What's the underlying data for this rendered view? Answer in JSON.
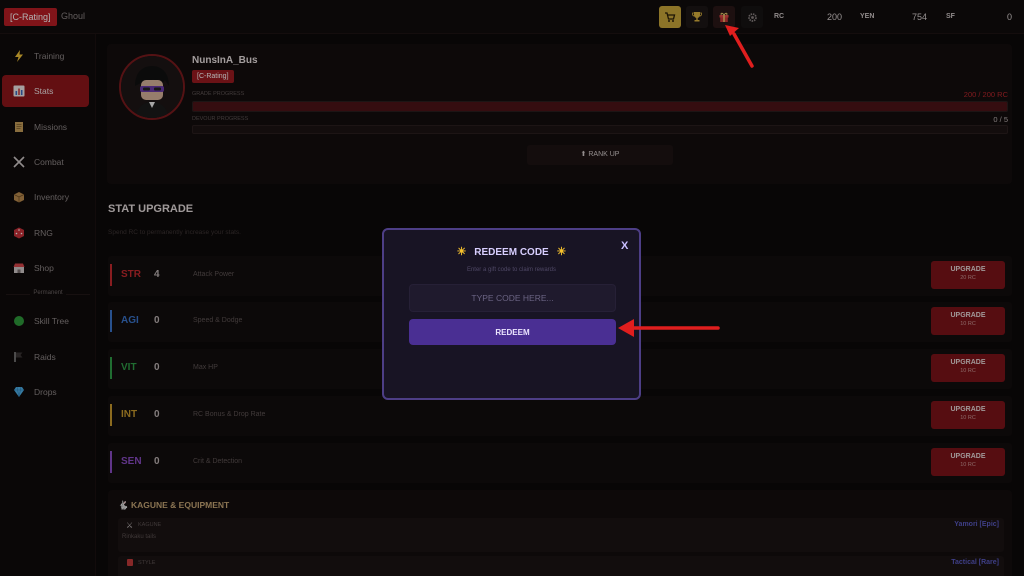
{
  "topbar": {
    "rating": "[C-Rating]",
    "race": "Ghoul",
    "icons": [
      "shop-icon",
      "trophy-icon",
      "gift-icon",
      "gear-icon"
    ],
    "currencies": [
      {
        "label": "RC",
        "value": "200",
        "color": "#b8262c"
      },
      {
        "label": "YEN",
        "value": "754",
        "color": "#c8a236"
      },
      {
        "label": "SF",
        "value": "0",
        "color": "#5d5ab8"
      }
    ]
  },
  "sidebar": {
    "items": [
      {
        "label": "Training",
        "icon": "lightning-icon"
      },
      {
        "label": "Stats",
        "icon": "chart-icon"
      },
      {
        "label": "Missions",
        "icon": "scroll-icon"
      },
      {
        "label": "Combat",
        "icon": "swords-icon"
      },
      {
        "label": "Inventory",
        "icon": "box-icon"
      },
      {
        "label": "RNG",
        "icon": "dice-icon"
      },
      {
        "label": "Shop",
        "icon": "store-icon"
      },
      {
        "label": "Skill Tree",
        "icon": "tree-icon"
      },
      {
        "label": "Raids",
        "icon": "flag-icon"
      },
      {
        "label": "Drops",
        "icon": "diamond-icon"
      }
    ],
    "separator_label": "Permanent",
    "active": "Stats"
  },
  "profile": {
    "name": "NunsInA_Bus",
    "rating": "[C-Rating]",
    "grade_label": "GRADE PROGRESS",
    "grade_value": "200 / 200 RC",
    "grade_fraction": 1.0,
    "devour_label": "DEVOUR PROGRESS",
    "devour_value": "0 / 5",
    "devour_fraction": 0.0,
    "rank_up_label": "⬆ RANK UP"
  },
  "stats": {
    "title": "STAT UPGRADE",
    "subtitle": "Spend RC to permanently increase your stats.",
    "upgrade_label": "UPGRADE",
    "rows": [
      {
        "code": "STR",
        "value": "4",
        "desc": "Attack Power",
        "cost": "20 RC",
        "color": "#c42a2f"
      },
      {
        "code": "AGI",
        "value": "0",
        "desc": "Speed & Dodge",
        "cost": "10 RC",
        "color": "#3a74cc"
      },
      {
        "code": "VIT",
        "value": "0",
        "desc": "Max HP",
        "cost": "10 RC",
        "color": "#2f9c47"
      },
      {
        "code": "INT",
        "value": "0",
        "desc": "RC Bonus & Drop Rate",
        "cost": "10 RC",
        "color": "#c99a2d"
      },
      {
        "code": "SEN",
        "value": "0",
        "desc": "Crit & Detection",
        "cost": "10 RC",
        "color": "#8a4cc4"
      }
    ]
  },
  "kagune": {
    "title": "KAGUNE & EQUIPMENT",
    "rows": [
      {
        "label": "KAGUNE",
        "sub": "Rinkaku tails",
        "value": "Yamori [Epic]"
      },
      {
        "label": "STYLE",
        "sub": "",
        "value": "Tactical [Rare]"
      }
    ]
  },
  "modal": {
    "title": "REDEEM CODE",
    "subtitle": "Enter a gift code to claim rewards",
    "placeholder": "TYPE CODE HERE...",
    "button": "REDEEM",
    "close": "X"
  }
}
